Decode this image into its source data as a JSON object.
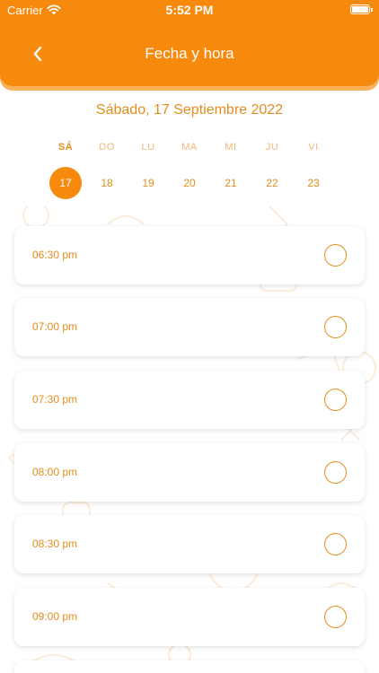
{
  "status_bar": {
    "carrier": "Carrier",
    "time": "5:52 PM"
  },
  "nav": {
    "title": "Fecha y hora",
    "back_icon": "chevron-left-icon"
  },
  "date_heading": "Sábado, 17 Septiembre 2022",
  "week": {
    "days": [
      {
        "name": "SÁ",
        "num": "17",
        "selected": true
      },
      {
        "name": "DO",
        "num": "18",
        "selected": false
      },
      {
        "name": "LU",
        "num": "19",
        "selected": false
      },
      {
        "name": "MA",
        "num": "20",
        "selected": false
      },
      {
        "name": "MI",
        "num": "21",
        "selected": false
      },
      {
        "name": "JU",
        "num": "22",
        "selected": false
      },
      {
        "name": "VI",
        "num": "23",
        "selected": false
      }
    ]
  },
  "slots": [
    {
      "time": "06:30 pm",
      "selected": false
    },
    {
      "time": "07:00 pm",
      "selected": false
    },
    {
      "time": "07:30 pm",
      "selected": false
    },
    {
      "time": "08:00 pm",
      "selected": false
    },
    {
      "time": "08:30 pm",
      "selected": false
    },
    {
      "time": "09:00 pm",
      "selected": false
    },
    {
      "time": "",
      "selected": false
    }
  ],
  "colors": {
    "accent": "#f7890d",
    "accent_text": "#e48d1c",
    "muted_text": "#f4b678"
  }
}
